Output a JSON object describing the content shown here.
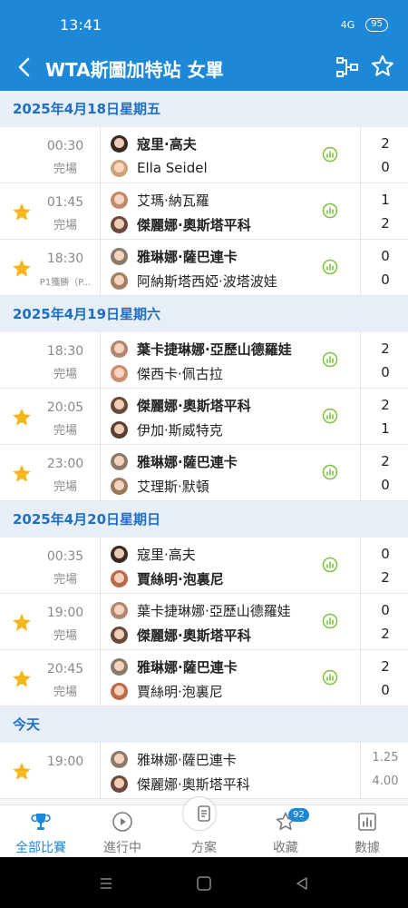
{
  "status_bar": {
    "time": "13:41",
    "battery": "95",
    "network": "4G"
  },
  "header": {
    "title": "WTA斯圖加特站 女單"
  },
  "sections": [
    {
      "date": "2025年4月18日星期五",
      "matches": [
        {
          "time": "00:30",
          "status": "完場",
          "fav": false,
          "p1": "寇里·高夫",
          "p2": "Ella Seidel",
          "s1": "2",
          "s2": "0",
          "winner": 1,
          "av1": "#3a2a22",
          "av2": "#c9a27a"
        },
        {
          "time": "01:45",
          "status": "完場",
          "fav": true,
          "p1": "艾瑪·納瓦羅",
          "p2": "傑麗娜·奧斯塔平科",
          "s1": "1",
          "s2": "2",
          "winner": 2,
          "av1": "#c08a6a",
          "av2": "#6a4a3a"
        },
        {
          "time": "18:30",
          "status": "P1獲勝（P...",
          "fav": true,
          "p1": "雅琳娜·薩巴連卡",
          "p2": "阿納斯塔西婭·波塔波娃",
          "s1": "0",
          "s2": "0",
          "winner": 1,
          "av1": "#8a7a6a",
          "av2": "#a08060"
        }
      ]
    },
    {
      "date": "2025年4月19日星期六",
      "matches": [
        {
          "time": "18:30",
          "status": "完場",
          "fav": false,
          "p1": "葉卡捷琳娜·亞歷山德羅娃",
          "p2": "傑西卡·佩古拉",
          "s1": "2",
          "s2": "0",
          "winner": 1,
          "av1": "#b08870",
          "av2": "#c89070"
        },
        {
          "time": "20:05",
          "status": "完場",
          "fav": true,
          "p1": "傑麗娜·奧斯塔平科",
          "p2": "伊加·斯威特克",
          "s1": "2",
          "s2": "1",
          "winner": 1,
          "av1": "#6a4a3a",
          "av2": "#5a4030"
        },
        {
          "time": "23:00",
          "status": "完場",
          "fav": true,
          "p1": "雅琳娜·薩巴連卡",
          "p2": "艾理斯·默頓",
          "s1": "2",
          "s2": "0",
          "winner": 1,
          "av1": "#8a7a6a",
          "av2": "#9a7a5a"
        }
      ]
    },
    {
      "date": "2025年4月20日星期日",
      "matches": [
        {
          "time": "00:35",
          "status": "完場",
          "fav": false,
          "p1": "寇里·高夫",
          "p2": "賈絲明·泡裏尼",
          "s1": "0",
          "s2": "2",
          "winner": 2,
          "av1": "#3a2a22",
          "av2": "#b86a4a"
        },
        {
          "time": "19:00",
          "status": "完場",
          "fav": true,
          "p1": "葉卡捷琳娜·亞歷山德羅娃",
          "p2": "傑麗娜·奧斯塔平科",
          "s1": "0",
          "s2": "2",
          "winner": 2,
          "av1": "#b08870",
          "av2": "#6a4a3a"
        },
        {
          "time": "20:45",
          "status": "完場",
          "fav": true,
          "p1": "雅琳娜·薩巴連卡",
          "p2": "賈絲明·泡裏尼",
          "s1": "2",
          "s2": "0",
          "winner": 1,
          "av1": "#8a7a6a",
          "av2": "#b86a4a"
        }
      ]
    },
    {
      "date": "今天",
      "matches": [
        {
          "time": "19:00",
          "status": "",
          "fav": true,
          "p1": "雅琳娜·薩巴連卡",
          "p2": "傑麗娜·奧斯塔平科",
          "s1": "1.25",
          "s2": "4.00",
          "winner": 0,
          "odds": true,
          "av1": "#8a7a6a",
          "av2": "#6a4a3a"
        }
      ]
    }
  ],
  "tabs": [
    {
      "label": "全部比賽",
      "icon": "trophy-icon",
      "active": true
    },
    {
      "label": "進行中",
      "icon": "play-icon",
      "active": false
    },
    {
      "label": "方案",
      "icon": "plan-icon",
      "active": false
    },
    {
      "label": "收藏",
      "icon": "star-icon",
      "active": false,
      "badge": "92"
    },
    {
      "label": "數據",
      "icon": "chart-icon",
      "active": false
    }
  ],
  "colors": {
    "primary": "#1e88d8",
    "star": "#f5b71f",
    "stats": "#7cc242"
  }
}
